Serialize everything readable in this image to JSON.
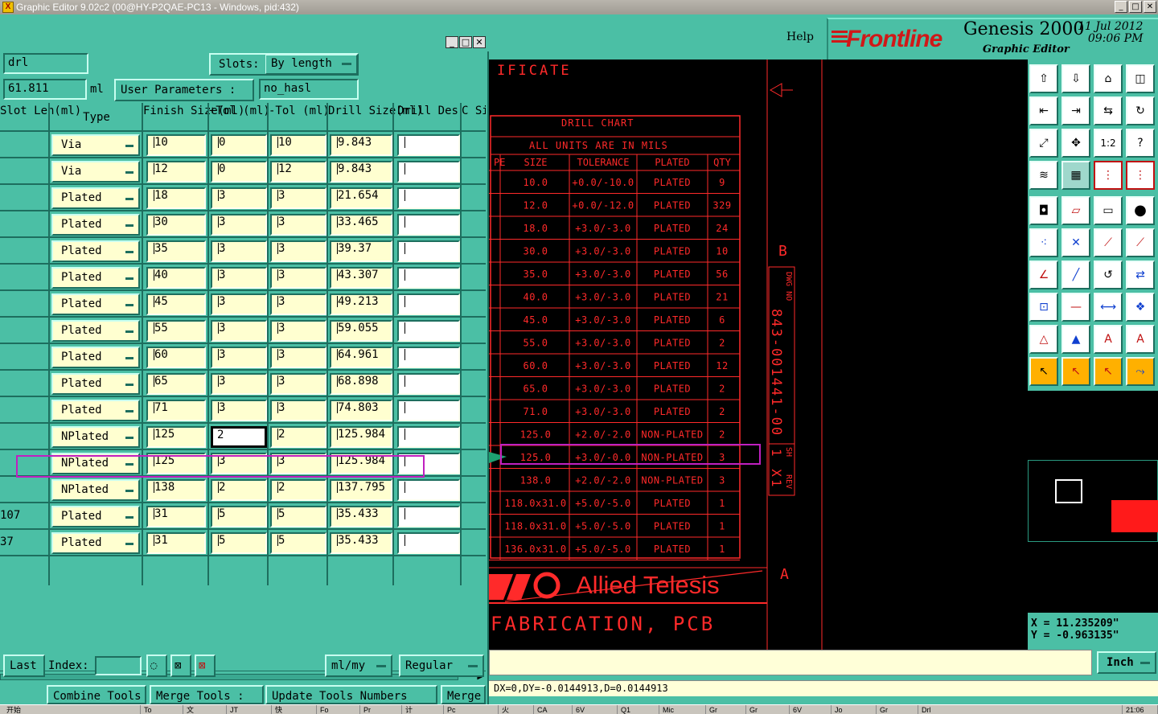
{
  "window": {
    "title": "Graphic Editor 9.02c2 (00@HY-P2QAE-PC13 - Windows, pid:432)",
    "buttons": [
      "_",
      "□",
      "✕"
    ]
  },
  "header": {
    "help": "Help",
    "brand": "Frontline",
    "product": "Genesis 2000",
    "subtitle": "Graphic Editor",
    "date": "11 Jul 2012",
    "time": "09:06 PM"
  },
  "drill_panel": {
    "layer": "drl",
    "slots_label": "Slots:",
    "slots_value": "By length",
    "measure_value": "61.811",
    "measure_unit": "ml",
    "user_params_label": "User Parameters :",
    "user_params_value": "no_hasl",
    "columns": [
      "Slot Len(ml)",
      "Type",
      "Finish Size(ml)",
      "+Tol (ml)",
      "-Tol (ml)",
      "Drill Size(ml)",
      "Drill Des",
      "C Siz"
    ],
    "rows": [
      {
        "slot": "",
        "type": "Via",
        "finish": "10",
        "ptol": "0",
        "mtol": "10",
        "drill": "9.843",
        "des": ""
      },
      {
        "slot": "",
        "type": "Via",
        "finish": "12",
        "ptol": "0",
        "mtol": "12",
        "drill": "9.843",
        "des": ""
      },
      {
        "slot": "",
        "type": "Plated",
        "finish": "18",
        "ptol": "3",
        "mtol": "3",
        "drill": "21.654",
        "des": ""
      },
      {
        "slot": "",
        "type": "Plated",
        "finish": "30",
        "ptol": "3",
        "mtol": "3",
        "drill": "33.465",
        "des": ""
      },
      {
        "slot": "",
        "type": "Plated",
        "finish": "35",
        "ptol": "3",
        "mtol": "3",
        "drill": "39.37",
        "des": ""
      },
      {
        "slot": "",
        "type": "Plated",
        "finish": "40",
        "ptol": "3",
        "mtol": "3",
        "drill": "43.307",
        "des": ""
      },
      {
        "slot": "",
        "type": "Plated",
        "finish": "45",
        "ptol": "3",
        "mtol": "3",
        "drill": "49.213",
        "des": ""
      },
      {
        "slot": "",
        "type": "Plated",
        "finish": "55",
        "ptol": "3",
        "mtol": "3",
        "drill": "59.055",
        "des": ""
      },
      {
        "slot": "",
        "type": "Plated",
        "finish": "60",
        "ptol": "3",
        "mtol": "3",
        "drill": "64.961",
        "des": ""
      },
      {
        "slot": "",
        "type": "Plated",
        "finish": "65",
        "ptol": "3",
        "mtol": "3",
        "drill": "68.898",
        "des": ""
      },
      {
        "slot": "",
        "type": "Plated",
        "finish": "71",
        "ptol": "3",
        "mtol": "3",
        "drill": "74.803",
        "des": ""
      },
      {
        "slot": "",
        "type": "NPlated",
        "finish": "125",
        "ptol": "2",
        "mtol": "2",
        "drill": "125.984",
        "des": ""
      },
      {
        "slot": "",
        "type": "NPlated",
        "finish": "125",
        "ptol": "3",
        "mtol": "3",
        "drill": "125.984",
        "des": ""
      },
      {
        "slot": "",
        "type": "NPlated",
        "finish": "138",
        "ptol": "2",
        "mtol": "2",
        "drill": "137.795",
        "des": ""
      },
      {
        "slot": "107",
        "type": "Plated",
        "finish": "31",
        "ptol": "5",
        "mtol": "5",
        "drill": "35.433",
        "des": ""
      },
      {
        "slot": "37",
        "type": "Plated",
        "finish": "31",
        "ptol": "5",
        "mtol": "5",
        "drill": "35.433",
        "des": ""
      }
    ],
    "last_label": "Last",
    "index_label": "Index:",
    "index_value": "",
    "unit_value": "ml/my",
    "mode_value": "Regular",
    "bottom_buttons": [
      "Combine Tools",
      "Merge Tools :",
      "Update Tools Numbers",
      "Merge"
    ]
  },
  "drawing": {
    "title_fragment": "IFICATE",
    "chart_title": "DRILL CHART",
    "chart_subtitle": "ALL UNITS ARE IN MILS",
    "columns": [
      "PE",
      "SIZE",
      "TOLERANCE",
      "PLATED",
      "QTY"
    ],
    "rows": [
      [
        "10.0",
        "+0.0/-10.0",
        "PLATED",
        "9"
      ],
      [
        "12.0",
        "+0.0/-12.0",
        "PLATED",
        "329"
      ],
      [
        "18.0",
        "+3.0/-3.0",
        "PLATED",
        "24"
      ],
      [
        "30.0",
        "+3.0/-3.0",
        "PLATED",
        "10"
      ],
      [
        "35.0",
        "+3.0/-3.0",
        "PLATED",
        "56"
      ],
      [
        "40.0",
        "+3.0/-3.0",
        "PLATED",
        "21"
      ],
      [
        "45.0",
        "+3.0/-3.0",
        "PLATED",
        "6"
      ],
      [
        "55.0",
        "+3.0/-3.0",
        "PLATED",
        "2"
      ],
      [
        "60.0",
        "+3.0/-3.0",
        "PLATED",
        "12"
      ],
      [
        "65.0",
        "+3.0/-3.0",
        "PLATED",
        "2"
      ],
      [
        "71.0",
        "+3.0/-3.0",
        "PLATED",
        "2"
      ],
      [
        "125.0",
        "+2.0/-2.0",
        "NON-PLATED",
        "2"
      ],
      [
        "125.0",
        "+3.0/-0.0",
        "NON-PLATED",
        "3"
      ],
      [
        "138.0",
        "+2.0/-2.0",
        "NON-PLATED",
        "3"
      ],
      [
        "118.0x31.0",
        "+5.0/-5.0",
        "PLATED",
        "1"
      ],
      [
        "118.0x31.0",
        "+5.0/-5.0",
        "PLATED",
        "1"
      ],
      [
        "136.0x31.0",
        "+5.0/-5.0",
        "PLATED",
        "1"
      ]
    ],
    "company": "Allied Telesis",
    "fab_text": "FABRICATION, PCB",
    "marker_b": "B",
    "marker_a": "A",
    "dwg_label": "DWG NO",
    "dwg_number": "843-001441-00",
    "sh_label": "SH",
    "sh_value": "1 X1",
    "rev_label": "REV"
  },
  "coords": {
    "x": "X = 11.235209\"",
    "y": "Y = -0.963135\""
  },
  "units_button": "Inch",
  "status": "DX=0,DY=-0.0144913,D=0.0144913",
  "taskbar": [
    "开始",
    "To",
    "文",
    "JT",
    "快",
    "Fo",
    "Pr",
    "计",
    "Pc",
    "火",
    "CA",
    "6V",
    "Q1",
    "Mic",
    "Gr",
    "Gr",
    "6V",
    "Jo",
    "Gr",
    "Drl",
    "21:06"
  ]
}
